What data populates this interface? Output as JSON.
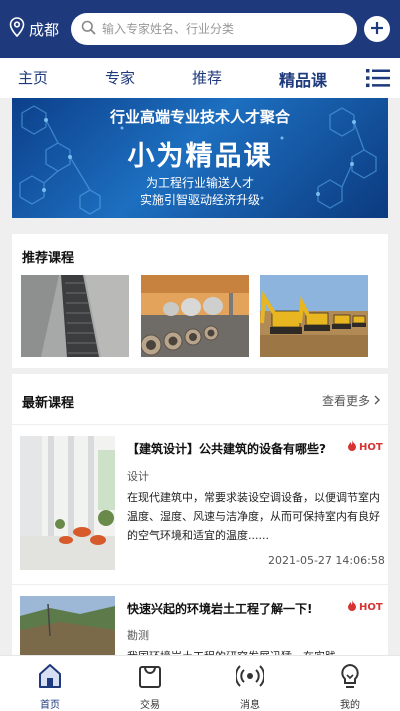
{
  "header": {
    "city": "成都",
    "search_placeholder": "输入专家姓名、行业分类"
  },
  "nav": {
    "tabs": [
      "主页",
      "专家",
      "推荐",
      "精品课"
    ],
    "active_tab": "精品课"
  },
  "banner": {
    "line1": "行业高端专业技术人才聚合",
    "line2": "小为精品课",
    "line3": "为工程行业输送人才",
    "line4": "实施引智驱动经济升级"
  },
  "recommended": {
    "title": "推荐课程",
    "items": [
      {
        "icon": "drainage-grate-image"
      },
      {
        "icon": "pipeline-plant-image"
      },
      {
        "icon": "excavators-image"
      }
    ]
  },
  "latest": {
    "title": "最新课程",
    "more": "查看更多",
    "courses": [
      {
        "title": "【建筑设计】公共建筑的设备有哪些?",
        "badge": "HOT",
        "category": "设计",
        "description": "在现代建筑中，常要求装设空调设备，以便调节室内温度、湿度、风速与洁净度，从而可保持室内有良好的空气环境和适宜的温度......",
        "date": "2021-05-27 14:06:58"
      },
      {
        "title": "快速兴起的环境岩土工程了解一下!",
        "badge": "HOT",
        "category": "勘测",
        "description": "我国环境岩土工程的研究发展迅猛，在实践"
      }
    ]
  },
  "bottom_nav": {
    "items": [
      "首页",
      "交易",
      "消息",
      "我的"
    ],
    "active": "首页"
  },
  "colors": {
    "brand_blue": "#1f3a7c",
    "hot_red": "#d63333"
  }
}
